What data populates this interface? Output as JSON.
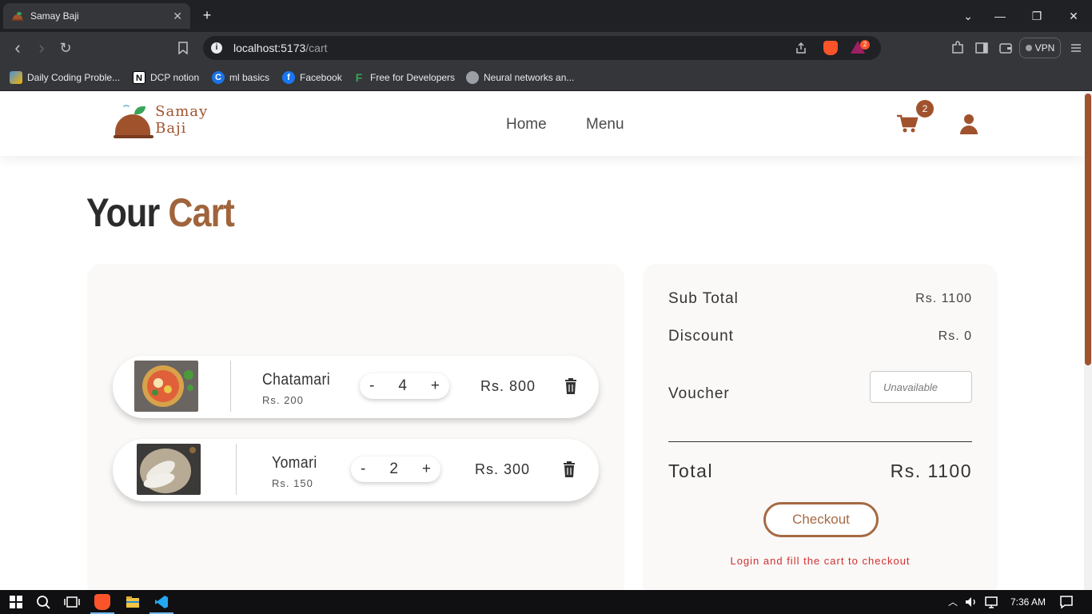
{
  "browser": {
    "tab_title": "Samay Baji",
    "tab_close": "✕",
    "new_tab": "+",
    "url_host": "localhost:5173",
    "url_path": "/cart",
    "bat_badge": "2",
    "vpn_label": "VPN",
    "window_controls": {
      "chevron": "⌄",
      "minimize": "—",
      "restore": "❐",
      "close": "✕"
    },
    "nav": {
      "back": "‹",
      "forward": "›",
      "reload": "↻"
    }
  },
  "bookmarks": [
    {
      "label": "Daily Coding Proble...",
      "icon": "colorful-icon",
      "color": "#4a90d9"
    },
    {
      "label": "DCP notion",
      "icon": "notion-icon",
      "color": "#ffffff"
    },
    {
      "label": "ml basics",
      "icon": "c-icon",
      "color": "#1a73e8"
    },
    {
      "label": "Facebook",
      "icon": "facebook-icon",
      "color": "#1877f2"
    },
    {
      "label": "Free for Developers",
      "icon": "f-icon",
      "color": "#34a853"
    },
    {
      "label": "Neural networks an...",
      "icon": "globe-icon",
      "color": "#9aa0a6"
    }
  ],
  "site": {
    "brand": "Samay Baji",
    "nav": {
      "home": "Home",
      "menu": "Menu"
    },
    "cart_count": "2",
    "accent": "#a0522d"
  },
  "page": {
    "title_word1": "Your",
    "title_word2": "Cart"
  },
  "cart": {
    "items": [
      {
        "name": "Chatamari",
        "unit_price": "Rs. 200",
        "qty_minus": "-",
        "qty": "4",
        "qty_plus": "+",
        "total": "Rs. 800"
      },
      {
        "name": "Yomari",
        "unit_price": "Rs. 150",
        "qty_minus": "-",
        "qty": "2",
        "qty_plus": "+",
        "total": "Rs. 300"
      }
    ]
  },
  "summary": {
    "subtotal_label": "Sub Total",
    "subtotal_value": "Rs. 1100",
    "discount_label": "Discount",
    "discount_value": "Rs. 0",
    "voucher_label": "Voucher",
    "voucher_placeholder": "Unavailable",
    "total_label": "Total",
    "total_value": "Rs. 1100",
    "checkout_label": "Checkout",
    "checkout_message": "Login and fill the cart to checkout"
  },
  "taskbar": {
    "time": "7:36 AM"
  }
}
